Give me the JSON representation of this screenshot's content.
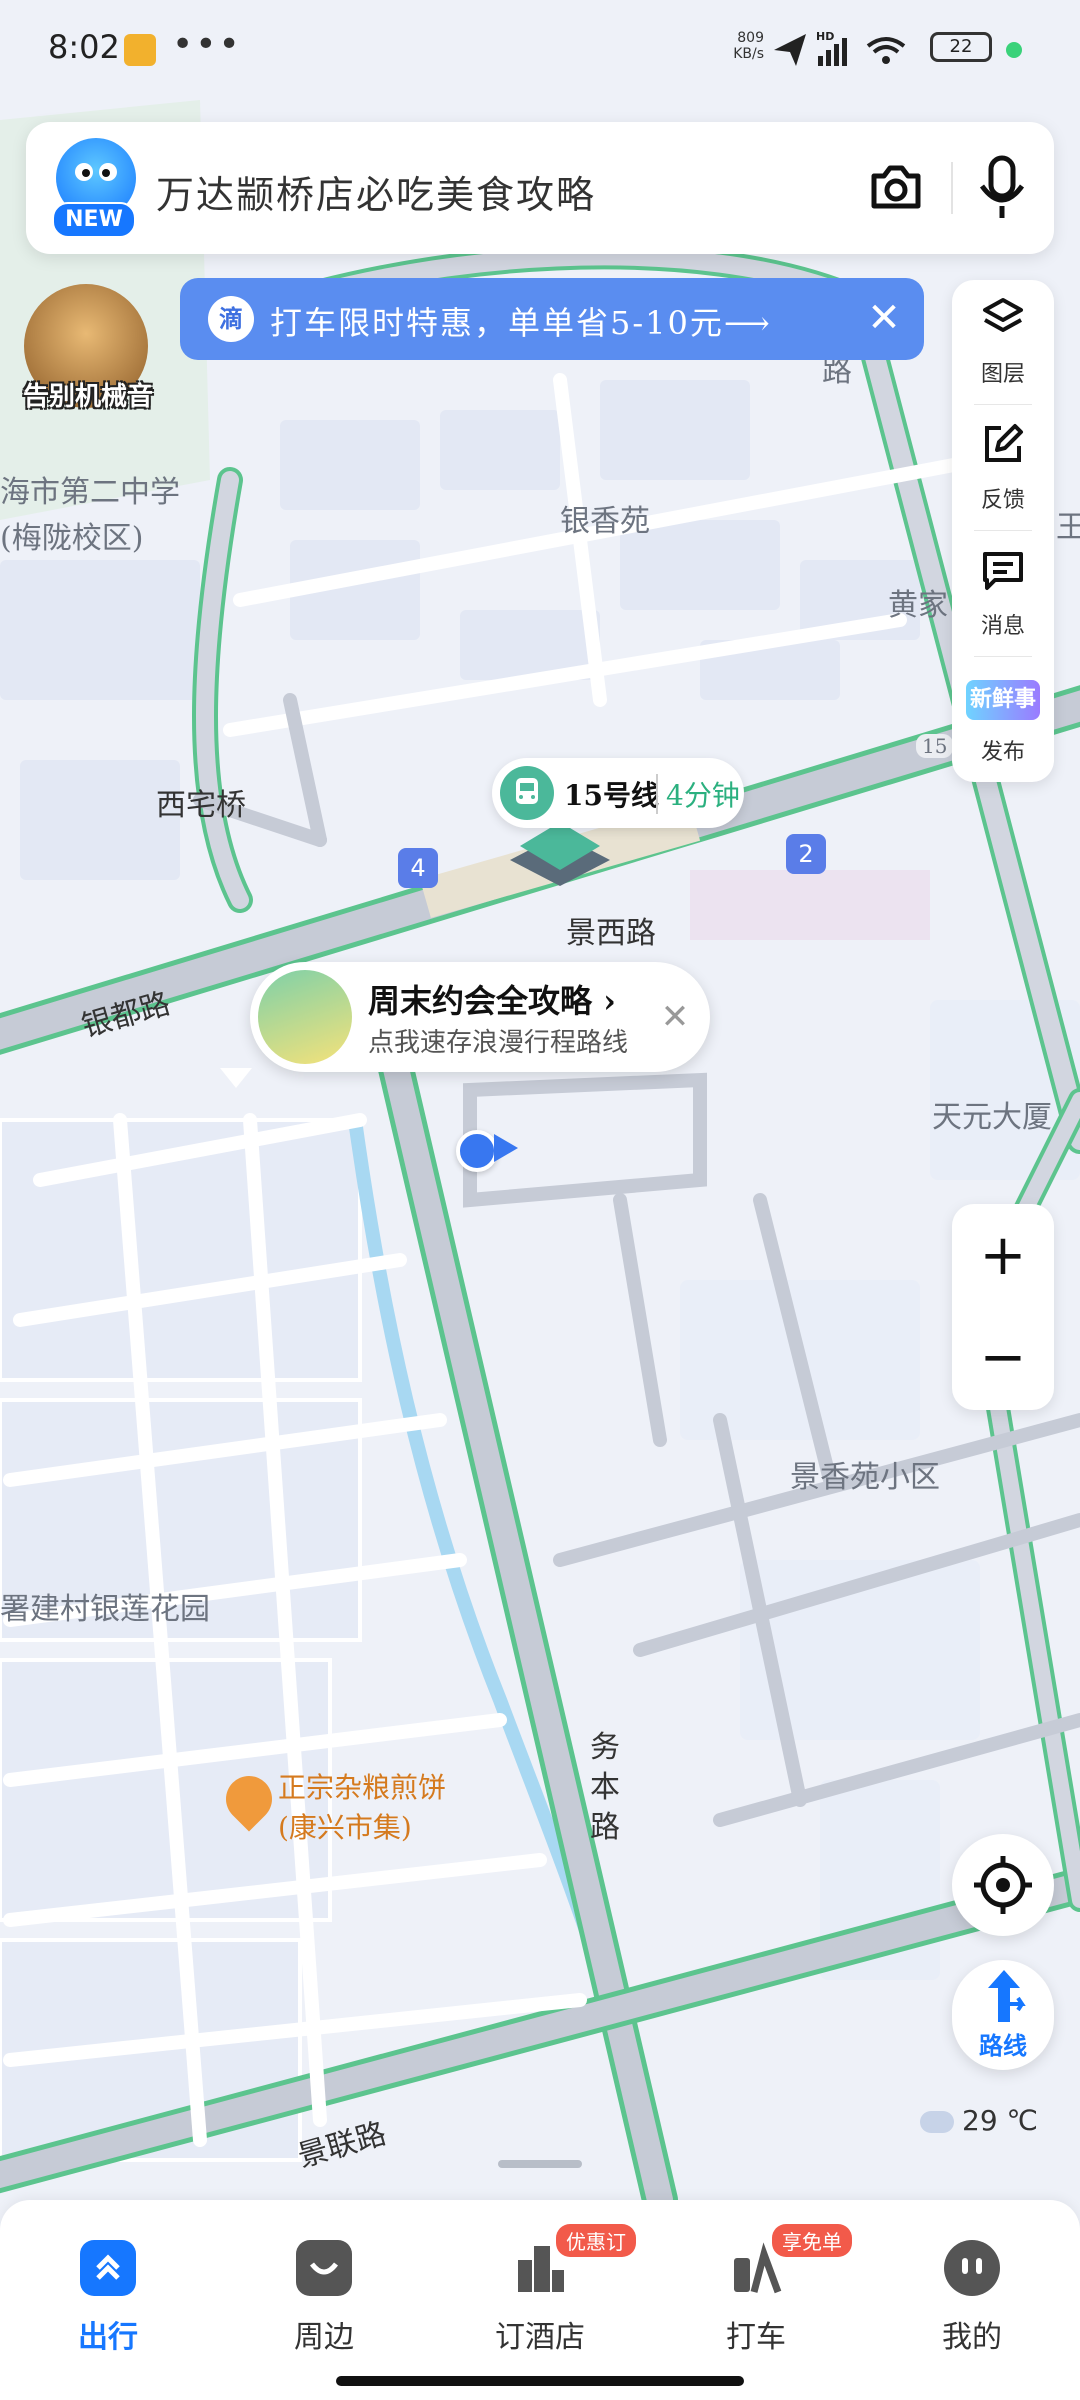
{
  "status_bar": {
    "time": "8:02",
    "network_speed": "809\nKB/s",
    "hd_label": "HD",
    "battery": "22"
  },
  "search": {
    "avatar_badge": "NEW",
    "query_hint": "万达颛桥店必吃美食攻略",
    "camera_icon": "camera-icon",
    "mic_icon": "mic-icon"
  },
  "voice_badge": {
    "label": "告别机械音"
  },
  "promo_banner": {
    "icon_text": "滴",
    "text": "打车限时特惠，单单省5-10元⟶",
    "close": "✕"
  },
  "side_toolbar": {
    "items": [
      {
        "label": "图层",
        "icon": "layers-icon"
      },
      {
        "label": "反馈",
        "icon": "edit-icon"
      },
      {
        "label": "消息",
        "icon": "message-icon"
      },
      {
        "label": "发布",
        "icon": "fresh-news-icon",
        "badge": "新鲜事"
      }
    ]
  },
  "map_labels": {
    "school": "海市第二中学\n(梅陇校区)",
    "yinxiangyuan": "银香苑",
    "huangjia": "黄家",
    "xizhaiqiao": "西宅桥",
    "jingxilu": "景西路",
    "yindulu": "银都路",
    "tianyuan": "天元大厦",
    "jingxiangyuan": "景香苑小区",
    "shujiancun": "署建村银莲花园",
    "wubenlu": "务本路",
    "jinglianlu": "景联路",
    "road_number": "15",
    "road_fragment": "路",
    "edge_fragment": "王"
  },
  "transit": {
    "line": "15号线",
    "time": "4分钟",
    "exit_left": "4",
    "exit_right": "2"
  },
  "station_card": {
    "title": "周末约会全攻略",
    "arrow": "›",
    "subtitle": "点我速存浪漫行程路线",
    "close": "✕"
  },
  "zoom": {
    "plus": "+",
    "minus": "−"
  },
  "poi": {
    "name": "正宗杂粮煎饼\n(康兴市集)"
  },
  "route_button": {
    "label": "路线"
  },
  "weather": {
    "temperature": "29 ℃"
  },
  "bottom_nav": {
    "items": [
      {
        "label": "出行",
        "active": true,
        "icon": "travel-icon"
      },
      {
        "label": "周边",
        "icon": "nearby-icon"
      },
      {
        "label": "订酒店",
        "badge": "优惠订",
        "icon": "hotel-icon"
      },
      {
        "label": "打车",
        "badge": "享免单",
        "icon": "taxi-icon"
      },
      {
        "label": "我的",
        "icon": "profile-icon"
      }
    ]
  },
  "colors": {
    "accent": "#1677ff",
    "road_green": "#5cc48e",
    "promo_blue": "#5a8df0",
    "badge_red": "#f25a4a"
  }
}
